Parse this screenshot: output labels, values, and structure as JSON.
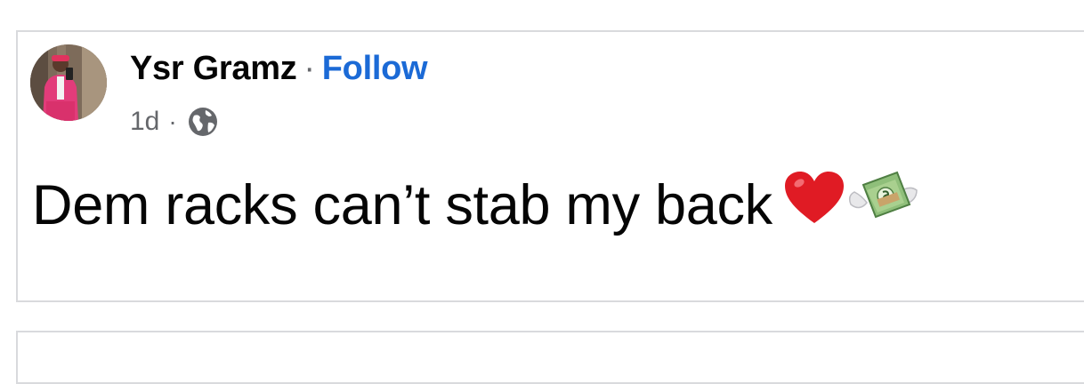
{
  "post": {
    "author": "Ysr Gramz",
    "separator": "·",
    "follow_label": "Follow",
    "timestamp": "1d",
    "meta_separator": "·",
    "privacy_icon": "globe-icon",
    "text": "Dem racks can’t stab my back",
    "emojis": [
      "red-heart-emoji",
      "money-with-wings-emoji"
    ]
  },
  "colors": {
    "follow": "#1b6ad6",
    "meta": "#65676b",
    "text": "#050505",
    "border": "#d9dadd"
  }
}
